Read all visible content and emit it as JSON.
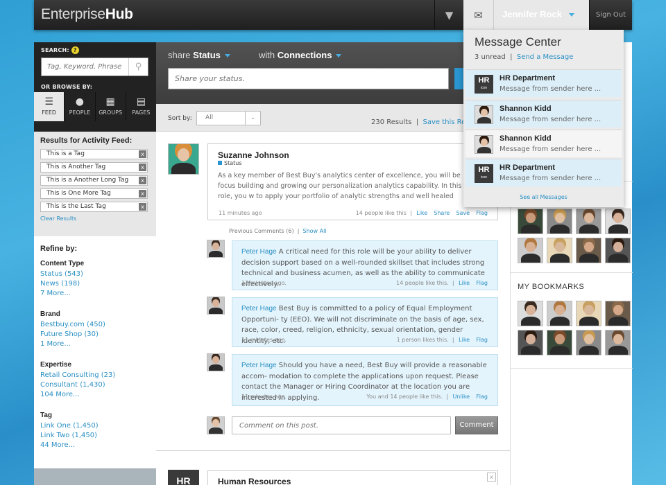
{
  "app": {
    "brand_prefix": "Enterprise",
    "brand_suffix": "Hub",
    "user_name": "Jennifer Rock",
    "sign_out": "Sign Out"
  },
  "search": {
    "label": "SEARCH:",
    "help": "?",
    "placeholder": "Tag, Keyword, Phrase",
    "browse_label": "OR BROWSE BY:"
  },
  "browse_tabs": [
    {
      "label": "FEED",
      "icon": "list-icon"
    },
    {
      "label": "PEOPLE",
      "icon": "person-icon"
    },
    {
      "label": "GROUPS",
      "icon": "grid-icon"
    },
    {
      "label": "PAGES",
      "icon": "page-icon"
    }
  ],
  "results": {
    "title": "Results for Activity Feed:",
    "tags": [
      "This is a Tag",
      "This is Another Tag",
      "This is a Another Long Tag",
      "This is One More Tag",
      "This is the Last Tag"
    ],
    "remove": "x",
    "clear": "Clear Results"
  },
  "refine": {
    "title": "Refine by:",
    "groups": [
      {
        "title": "Content Type",
        "links": [
          "Status (543)",
          "News (198)",
          "7 More..."
        ]
      },
      {
        "title": "Brand",
        "links": [
          "Bestbuy.com (450)",
          "Future Shop (30)",
          "1 More..."
        ]
      },
      {
        "title": "Expertise",
        "links": [
          "Retail Consulting (23)",
          "Consultant (1,430)",
          "104 More..."
        ]
      },
      {
        "title": "Tag",
        "links": [
          "Link One (1,450)",
          "Link Two (1,450)",
          "44 More..."
        ]
      }
    ]
  },
  "share": {
    "tab1_prefix": "share",
    "tab1_bold": "Status",
    "tab2_prefix": "with",
    "tab2_bold": "Connections",
    "placeholder": "Share your status."
  },
  "sort": {
    "label": "Sort by:",
    "value": "All",
    "count": "230 Results",
    "divider": "|",
    "save": "Save this Re"
  },
  "post": {
    "name": "Suzanne Johnson",
    "type": "Status",
    "text": "As a key member of Best Buy's analytics center of excellence, you will be focus building and growing our personalization analytics capability. In this role, you w to apply your portfolio of analytic strengths and well healed consulting skills.",
    "time": "11 minutes ago",
    "likes": "14 people like this",
    "actions": [
      "Like",
      "Share",
      "Save",
      "Flag"
    ]
  },
  "prev_comments": {
    "label": "Previous Comments (6)",
    "divider": "|",
    "show_all": "Show All"
  },
  "comments": [
    {
      "name": "Peter Hage",
      "text": "A critical need for this role will be your ability to deliver decision support based on a well-rounded skillset that includes strong technical and business acumen, as well as the ability to communicate effectively.",
      "time": "11 minutes ago.",
      "likes": "14 people like this.",
      "action1": "Like",
      "action2": "Flag"
    },
    {
      "name": "Peter Hage",
      "text": "Best Buy is committed to a policy of Equal Employment Opportuni- ty (EEO). We will not discriminate on the basis of age, sex, race, color, creed, religion, ethnicity, sexual orientation, gender identity, etc.",
      "time": "11 minutes ago.",
      "likes": "1 person likes this.",
      "action1": "Like",
      "action2": "Flag"
    },
    {
      "name": "Peter Hage",
      "text": "Should you have a need, Best Buy will provide a reasonable accom- modation to complete the applications upon request. Please contact the Manager or Hiring Coordinator at the location you are interested in applying.",
      "time": "11 minutes ago.",
      "likes": "You and 14 people like this.",
      "action1": "Unlike",
      "action2": "Flag"
    }
  ],
  "comment_box": {
    "placeholder": "Comment on this post.",
    "button": "Comment"
  },
  "hr_card": {
    "icon": "HR",
    "name": "Human Resources",
    "close": "x"
  },
  "right": {
    "bookmarks_title": "MY BOOKMARKS"
  },
  "messages": {
    "title": "Message Center",
    "unread": "3 unread",
    "divider": "|",
    "send": "Send a Message",
    "items": [
      {
        "name": "HR Department",
        "sub": "Message from sender here ...",
        "icon": "HR",
        "icon_sub": "icon"
      },
      {
        "name": "Shannon Kidd",
        "sub": "Message from sender here ..."
      },
      {
        "name": "Shannon Kidd",
        "sub": "Message from sender here ..."
      },
      {
        "name": "HR Department",
        "sub": "Message from sender here ...",
        "icon": "HR",
        "icon_sub": "icon"
      }
    ],
    "see_all": "See all Messages"
  },
  "colors": {
    "accent": "#2a95d0",
    "topbar": "#2a2a2a",
    "link": "#2a8fc4"
  }
}
